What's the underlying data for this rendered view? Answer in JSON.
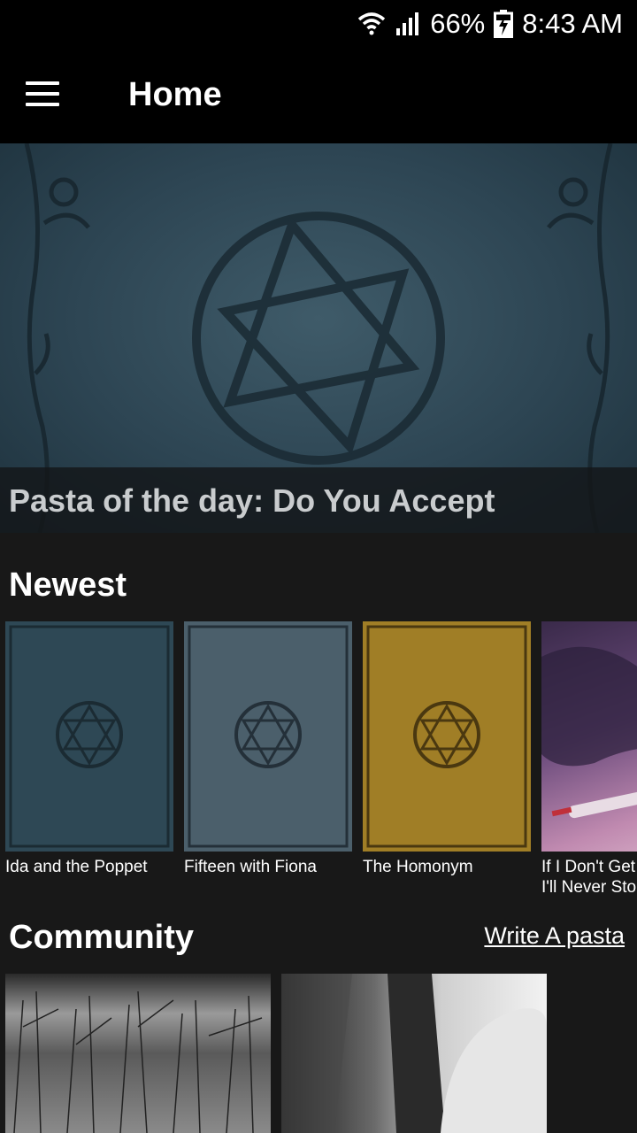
{
  "status_bar": {
    "battery": "66%",
    "time": "8:43 AM",
    "icons": [
      "wifi-icon",
      "signal-icon",
      "battery-charging-icon"
    ]
  },
  "app_bar": {
    "title": "Home",
    "menu_icon": "hamburger-menu-icon"
  },
  "hero": {
    "caption": "Pasta of the day: Do You Accept"
  },
  "newest": {
    "title": "Newest",
    "items": [
      {
        "label": "Ida and the Poppet",
        "color": "#2e4855"
      },
      {
        "label": "Fifteen with Fiona",
        "color": "#4b5f6b"
      },
      {
        "label": "The Homonym",
        "color": "#a07e26"
      },
      {
        "label": "If I Don't Get\nI'll Never Sto",
        "color": "#5a3f6a"
      }
    ]
  },
  "community": {
    "title": "Community",
    "write_link": "Write A pasta"
  },
  "colors": {
    "background": "#181818",
    "app_bar": "#000000",
    "hero_teal": "#2d4553"
  }
}
